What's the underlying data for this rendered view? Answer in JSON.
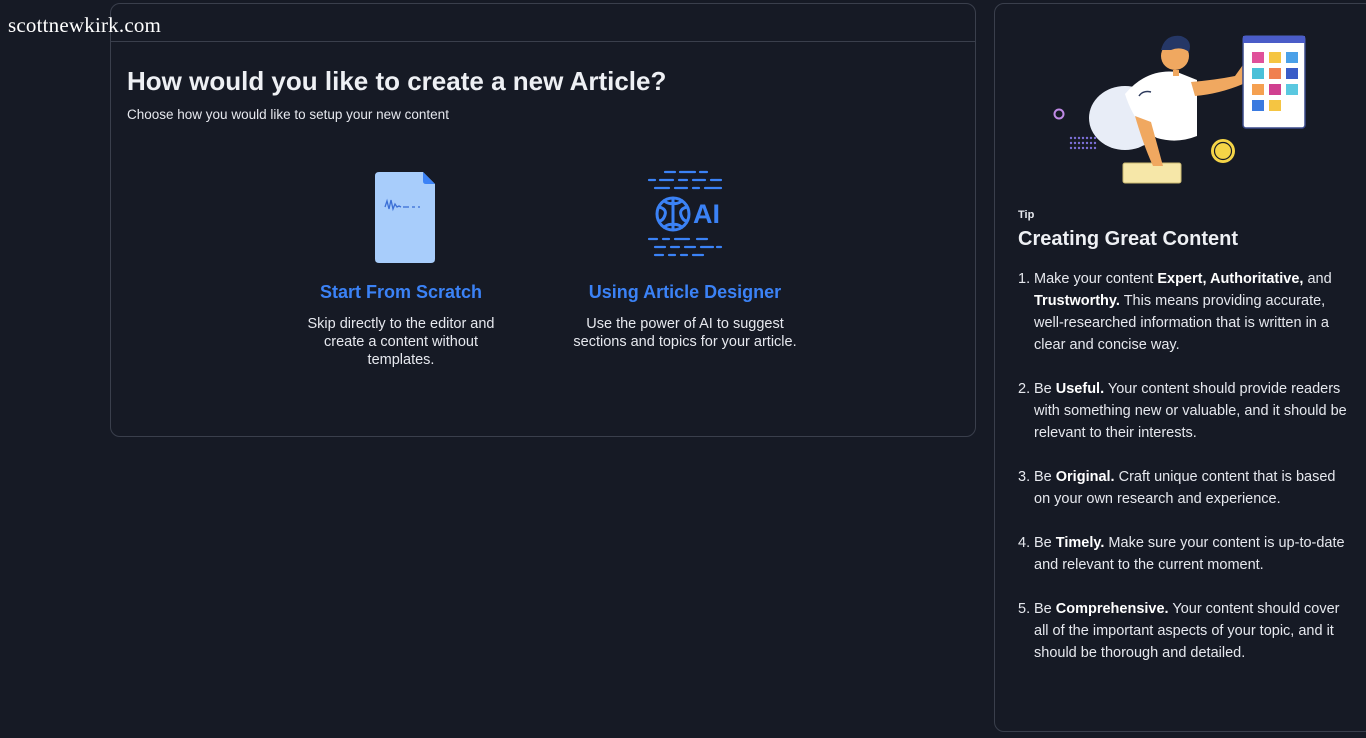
{
  "watermark": "scottnewkirk.com",
  "main": {
    "title": "How would you like to create a new Article?",
    "subtitle": "Choose how you would like to setup your new content",
    "options": [
      {
        "title": "Start From Scratch",
        "description": "Skip directly to the editor and create a content without templates.",
        "icon": "document-icon"
      },
      {
        "title": "Using Article Designer",
        "description": "Use the power of AI to suggest sections and topics for your article.",
        "icon": "ai-brain-icon",
        "icon_text": "AI"
      }
    ]
  },
  "tip": {
    "label": "Tip",
    "heading": "Creating Great Content",
    "items": [
      {
        "num": "1.",
        "pre": "Make your content ",
        "bold": "Expert, Authoritative,",
        "mid": " and ",
        "bold2": "Trustworthy.",
        "post": " This means providing accurate, well-researched information that is written in a clear and concise way."
      },
      {
        "num": "2.",
        "pre": "Be ",
        "bold": "Useful.",
        "mid": "",
        "bold2": "",
        "post": " Your content should provide readers with something new or valuable, and it should be relevant to their interests."
      },
      {
        "num": "3.",
        "pre": "Be ",
        "bold": "Original.",
        "mid": "",
        "bold2": "",
        "post": " Craft unique content that is based on your own research and experience."
      },
      {
        "num": "4.",
        "pre": "Be ",
        "bold": "Timely.",
        "mid": "",
        "bold2": "",
        "post": " Make sure your content is up-to-date and relevant to the current moment."
      },
      {
        "num": "5.",
        "pre": "Be ",
        "bold": "Comprehensive.",
        "mid": "",
        "bold2": "",
        "post": " Your content should cover all of the important aspects of your topic, and it should be thorough and detailed."
      }
    ]
  },
  "colors": {
    "background": "#161a25",
    "border": "#3a3f4c",
    "accent": "#3b82f6",
    "doc_fill": "#a8cdfb"
  }
}
